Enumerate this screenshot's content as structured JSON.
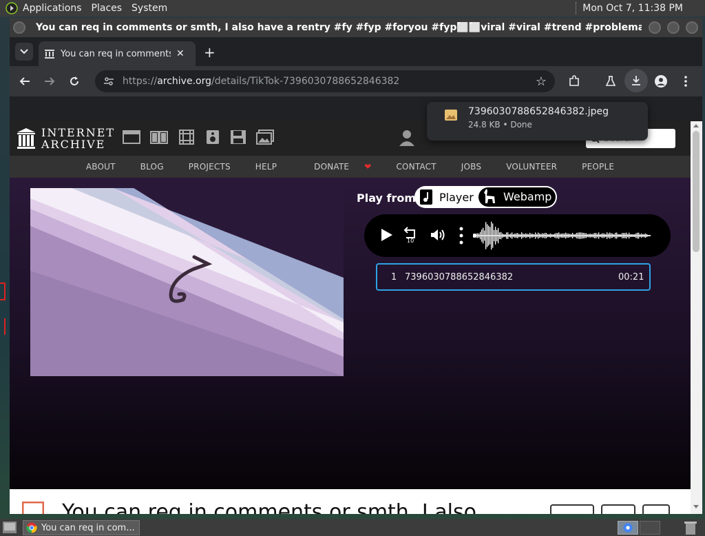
{
  "top_panel": {
    "menus": [
      "Applications",
      "Places",
      "System"
    ],
    "clock": "Mon Oct  7, 11:38 PM"
  },
  "window": {
    "title": "You can req in comments or smth, I also have a rentry #fy #fyp #foryou #fyp⬜⬜viral #viral #trend #problematic #lgbtq #lgbrqflags #flags..."
  },
  "tab": {
    "title": "You can req in comments or"
  },
  "omnibox": {
    "url_prefix": "https://",
    "url_domain": "archive.org",
    "url_path": "/details/TikTok-7396030788652846382"
  },
  "download": {
    "filename": "7396030788652846382.jpeg",
    "status": "24.8 KB • Done"
  },
  "ia": {
    "logo_line1": "INTERNET",
    "logo_line2": "ARCHIVE",
    "search_placeholder": "Search",
    "nav": [
      "ABOUT",
      "BLOG",
      "PROJECTS",
      "HELP",
      "DONATE",
      "CONTACT",
      "JOBS",
      "VOLUNTEER",
      "PEOPLE"
    ],
    "play_from_label": "Play from:",
    "player_option": "Player",
    "webamp_option": "Webamp",
    "playlist": {
      "index": "1",
      "name": "7396030788652846382",
      "duration": "00:21"
    },
    "item_title_partial": "You can req in comments or smth, I also"
  },
  "taskbar": {
    "window_label": "You can req in com..."
  },
  "colors": {
    "accent_blue": "#2ea3e6",
    "donate_heart": "#e02b2b",
    "flag_stripes": [
      "#9eaad0",
      "#c8cce0",
      "#f4eef8",
      "#e2d0ea",
      "#c9b0d8",
      "#a88cbc"
    ]
  }
}
